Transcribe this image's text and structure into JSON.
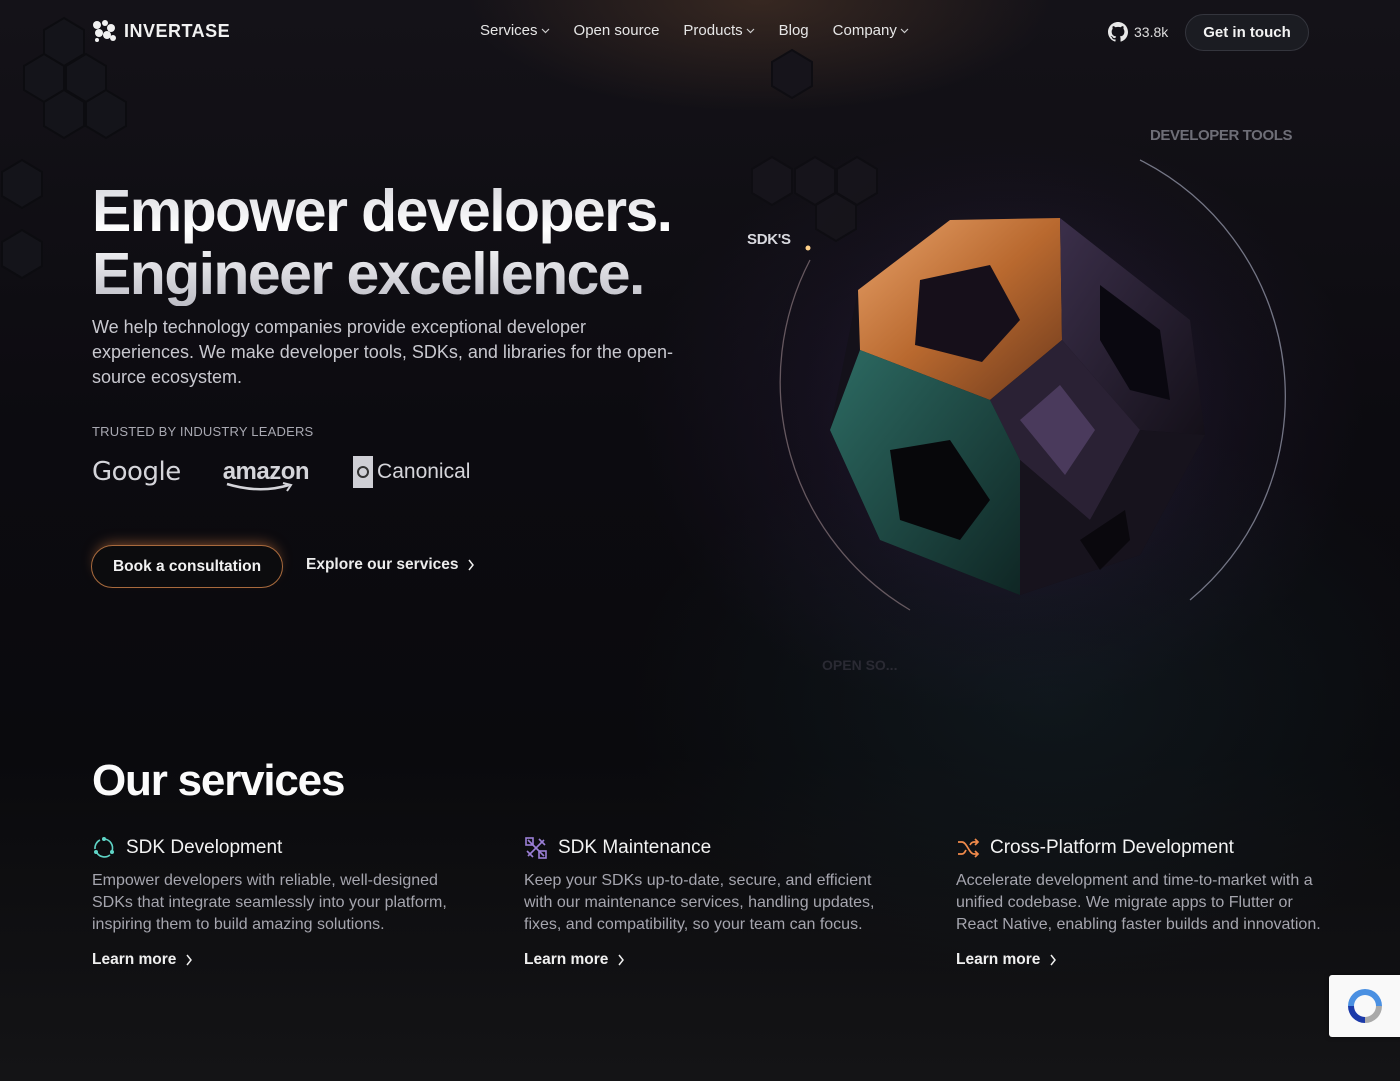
{
  "header": {
    "brand": "INVERTASE",
    "nav": [
      {
        "label": "Services",
        "dropdown": true
      },
      {
        "label": "Open source",
        "dropdown": false
      },
      {
        "label": "Products",
        "dropdown": true
      },
      {
        "label": "Blog",
        "dropdown": false
      },
      {
        "label": "Company",
        "dropdown": true
      }
    ],
    "github_stars": "33.8k",
    "cta": "Get in touch"
  },
  "hero": {
    "title_line1": "Empower developers.",
    "title_line2": "Engineer excellence.",
    "subtitle": "We help technology companies provide exceptional developer experiences. We make developer tools, SDKs, and libraries for the open-source ecosystem.",
    "trusted_label": "TRUSTED BY INDUSTRY LEADERS",
    "logos": [
      "Google",
      "amazon",
      "Canonical"
    ],
    "primary_button": "Book a consultation",
    "secondary_button": "Explore our services",
    "orbit_labels": {
      "sdks": "SDK'S",
      "developer_tools": "DEVELOPER TOOLS",
      "open_source": "OPEN SO..."
    }
  },
  "services": {
    "title": "Our services",
    "items": [
      {
        "title": "SDK Development",
        "description": "Empower developers with reliable, well-designed SDKs that integrate seamlessly into your platform, inspiring them to build amazing solutions.",
        "link": "Learn more",
        "icon": "cycle-icon",
        "color": "#5fd4c6"
      },
      {
        "title": "SDK Maintenance",
        "description": "Keep your SDKs up-to-date, secure, and efficient with our maintenance services, handling updates, fixes, and compatibility, so your team can focus.",
        "link": "Learn more",
        "icon": "tools-icon",
        "color": "#9b7fd6"
      },
      {
        "title": "Cross-Platform Development",
        "description": "Accelerate development and time-to-market with a unified codebase. We migrate apps to Flutter or React Native, enabling faster builds and innovation.",
        "link": "Learn more",
        "icon": "shuffle-icon",
        "color": "#f08a4b"
      }
    ]
  },
  "colors": {
    "background": "#0a0a0c",
    "accent_copper": "#c7783e",
    "accent_teal": "#1f4a48"
  }
}
